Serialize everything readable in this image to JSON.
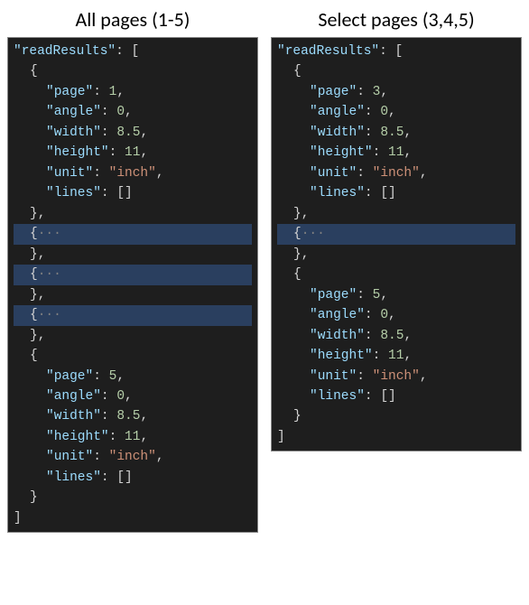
{
  "left": {
    "title": "All pages (1-5)",
    "root_key": "readResults",
    "first": {
      "page_key": "page",
      "page_val": 1,
      "angle_key": "angle",
      "angle_val": 0,
      "width_key": "width",
      "width_val": 8.5,
      "height_key": "height",
      "height_val": 11,
      "unit_key": "unit",
      "unit_val": "inch",
      "lines_key": "lines",
      "lines_val": "[]"
    },
    "collapsed_count": 3,
    "last": {
      "page_key": "page",
      "page_val": 5,
      "angle_key": "angle",
      "angle_val": 0,
      "width_key": "width",
      "width_val": 8.5,
      "height_key": "height",
      "height_val": 11,
      "unit_key": "unit",
      "unit_val": "inch",
      "lines_key": "lines",
      "lines_val": "[]"
    }
  },
  "right": {
    "title": "Select pages (3,4,5)",
    "root_key": "readResults",
    "first": {
      "page_key": "page",
      "page_val": 3,
      "angle_key": "angle",
      "angle_val": 0,
      "width_key": "width",
      "width_val": 8.5,
      "height_key": "height",
      "height_val": 11,
      "unit_key": "unit",
      "unit_val": "inch",
      "lines_key": "lines",
      "lines_val": "[]"
    },
    "collapsed_count": 1,
    "last": {
      "page_key": "page",
      "page_val": 5,
      "angle_key": "angle",
      "angle_val": 0,
      "width_key": "width",
      "width_val": 8.5,
      "height_key": "height",
      "height_val": 11,
      "unit_key": "unit",
      "unit_val": "inch",
      "lines_key": "lines",
      "lines_val": "[]"
    }
  },
  "tokens": {
    "open_brace": "{",
    "close_brace": "}",
    "open_bracket": "[",
    "close_bracket": "]",
    "colon": ": ",
    "comma": ",",
    "dots": "···",
    "quote": "\""
  }
}
